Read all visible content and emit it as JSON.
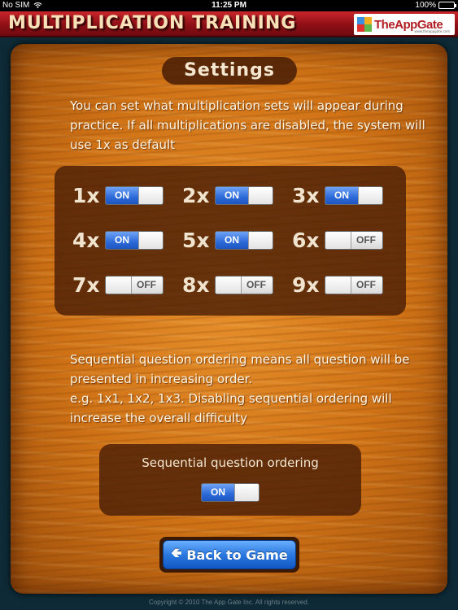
{
  "status_bar": {
    "carrier": "No SIM",
    "time": "11:25 PM",
    "battery": "100%"
  },
  "header": {
    "title": "MULTIPLICATION TRAINING",
    "logo_text": "TheAppGate",
    "logo_sub": "www.theappgate.com"
  },
  "settings": {
    "title": "Settings",
    "description": "You can set what multiplication sets will appear during practice. If all multiplications are disabled, the system will use 1x as default",
    "multiplications": [
      {
        "label": "1x",
        "state": "ON"
      },
      {
        "label": "2x",
        "state": "ON"
      },
      {
        "label": "3x",
        "state": "ON"
      },
      {
        "label": "4x",
        "state": "ON"
      },
      {
        "label": "5x",
        "state": "ON"
      },
      {
        "label": "6x",
        "state": "OFF"
      },
      {
        "label": "7x",
        "state": "OFF"
      },
      {
        "label": "8x",
        "state": "OFF"
      },
      {
        "label": "9x",
        "state": "OFF"
      }
    ],
    "sequential_description_1": "Sequential question ordering means all question will be presented in increasing order.",
    "sequential_description_2": "e.g. 1x1, 1x2, 1x3. Disabling sequential ordering will increase the overall difficulty",
    "sequential_label": "Sequential question ordering",
    "sequential_state": "ON",
    "on_text": "ON",
    "off_text": "OFF"
  },
  "back_button": {
    "label": "Back to Game"
  },
  "footer": {
    "copyright": "Copyright © 2010 The App Gate Inc. All rights reserved."
  },
  "colors": {
    "header_red": "#a3161c",
    "toggle_blue": "#2c6ad8",
    "wood": "#cf7216",
    "panel": "#4a1e06"
  }
}
